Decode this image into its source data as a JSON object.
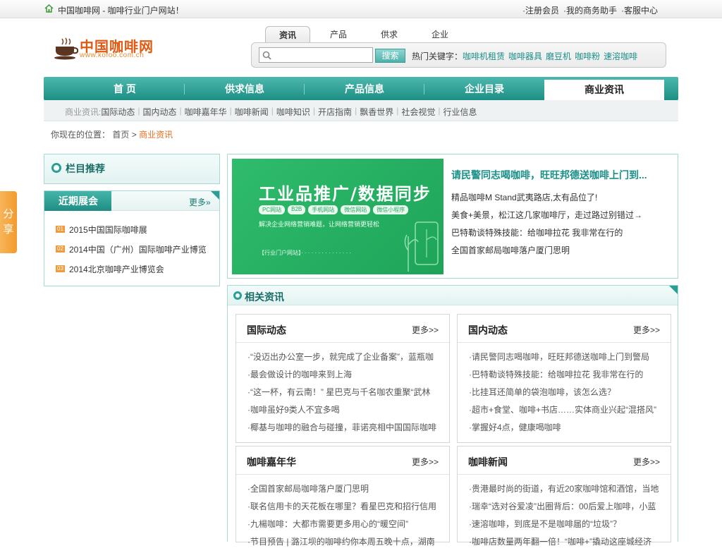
{
  "topbar": {
    "site": "中国咖啡网 - 咖啡行业门户网站！",
    "links": [
      "·注册会员",
      "·我的商务助手",
      "·客服中心"
    ]
  },
  "logo": {
    "title": "中国咖啡网",
    "url": "www.kofoo.com.cn"
  },
  "search": {
    "tabs": [
      "资讯",
      "产品",
      "供求",
      "企业"
    ],
    "button": "搜索",
    "hot_label": "热门关键字：",
    "keywords": [
      "咖啡机租赁",
      "咖啡器具",
      "磨豆机",
      "咖啡粉",
      "速溶咖啡"
    ]
  },
  "nav": {
    "items": [
      "首 页",
      "供求信息",
      "产品信息",
      "企业目录",
      "商业资讯"
    ]
  },
  "subnav": {
    "label": "商业资讯:",
    "items": [
      "国际动态",
      "国内动态",
      "咖啡嘉年华",
      "咖啡新闻",
      "咖啡知识",
      "开店指南",
      "飘香世界",
      "社会视觉",
      "行业信息"
    ]
  },
  "crumb": {
    "prefix": "你现在的位置：",
    "home": "首页",
    "sep": " > ",
    "current": "商业资讯"
  },
  "share": {
    "label1": "分",
    "label2": "享"
  },
  "sidebar": {
    "rec_title": "栏目推荐",
    "exh_title": "近期展会",
    "exh_more": "更多»",
    "exh_items": [
      {
        "n": "01",
        "t": "2015中国国际咖啡展"
      },
      {
        "n": "02",
        "t": "2014中国（广州）国际咖啡产业博览"
      },
      {
        "n": "03",
        "t": "2014北京咖啡产业博览会"
      }
    ]
  },
  "banner": {
    "headline": "工业品推广/数据同步",
    "pills": [
      "PC网站",
      "B2B",
      "手机网站",
      "微信网站",
      "微信小程序"
    ],
    "sub": "解决企业网络营销难题，让网络营销更轻松",
    "footer": "【行业门户网站】· · · · · · · · · · · · · · ·"
  },
  "featured": {
    "title": "请民警同志喝咖啡，旺旺邦德送咖啡上门到...",
    "items": [
      "精品咖啡M Stand武夷路店,太有品位了!",
      "美食+美景，松江这几家咖啡厅，走过路过别错过→",
      "巴特勒谈特殊技能：给咖啡拉花 我非常在行的",
      "全国首家邮局咖啡落户厦门思明"
    ]
  },
  "related": {
    "title": "相关资讯",
    "boxes": [
      {
        "title": "国际动态",
        "more": "更多>>",
        "items": [
          "·“没迈出办公室一步，就完成了企业备案”，蓝瓶咖",
          "·最会做设计的咖啡来到上海",
          "·“这一杯，有云南！” 星巴克与千名咖农重聚“武林",
          "·咖啡虽好9类人不宜多喝",
          "·椰基与咖啡的融合与碰撞，菲诺亮相中国国际咖啡"
        ]
      },
      {
        "title": "国内动态",
        "more": "更多>>",
        "items": [
          "·请民警同志喝咖啡，旺旺邦德送咖啡上门到警局",
          "·巴特勒谈特殊技能：给咖啡拉花 我非常在行的",
          "·比挂耳还简单的袋泡咖啡，该怎么选？",
          "·超市+食堂、咖啡+书店……实体商业兴起“混搭风”",
          "·掌握好4点，健康喝咖啡"
        ]
      },
      {
        "title": "咖啡嘉年华",
        "more": "更多>>",
        "items": [
          "·全国首家邮局咖啡落户厦门思明",
          "·联名信用卡的天花板在哪里？看星巴克和招行信用",
          "·九楊咖啡：大都市需要更多用心的“暖空间”",
          "·节目预告 | 潞江坝的咖啡约你本周五晚十点，湖南"
        ]
      },
      {
        "title": "咖啡新闻",
        "more": "更多>>",
        "items": [
          "·贵港最时尚的街道，有近20家咖啡馆和酒馆，当地",
          "·瑞幸“选对谷爱凌”出圈背后：00后爱上咖啡，小蓝",
          "·速溶咖啡，到底是不是咖啡届的“垃圾”？",
          "·咖啡店数量两年翻一倍！“咖啡+”撬动这座城经济"
        ]
      }
    ]
  }
}
